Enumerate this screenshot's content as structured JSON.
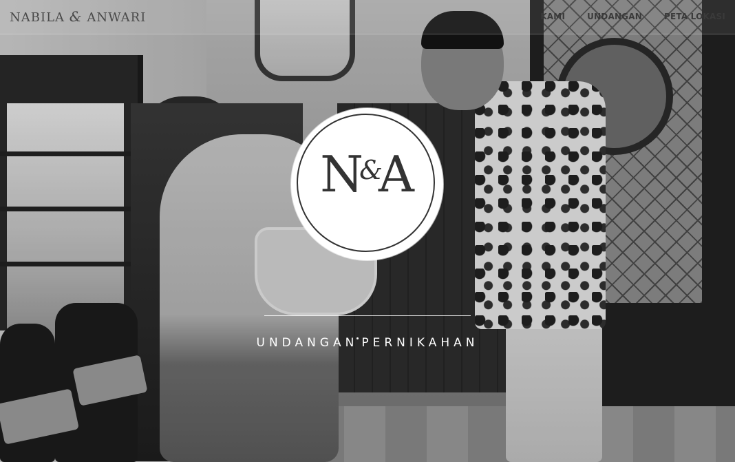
{
  "navbar": {
    "brand_first": "NABILA",
    "brand_amp": "&",
    "brand_second": "ANWARI",
    "links": [
      "KAMI",
      "UNDANGAN",
      "PETA LOKASI"
    ]
  },
  "hero": {
    "monogram_left": "N",
    "monogram_amp": "&",
    "monogram_right": "A",
    "subtitle_part1": "UNDANGAN",
    "subtitle_part2": "PERNIKAHAN"
  },
  "colors": {
    "emblem_bg": "#ffffff",
    "monogram": "#333333",
    "nav_text": "#3a3a3a",
    "subtitle": "#ffffff"
  }
}
